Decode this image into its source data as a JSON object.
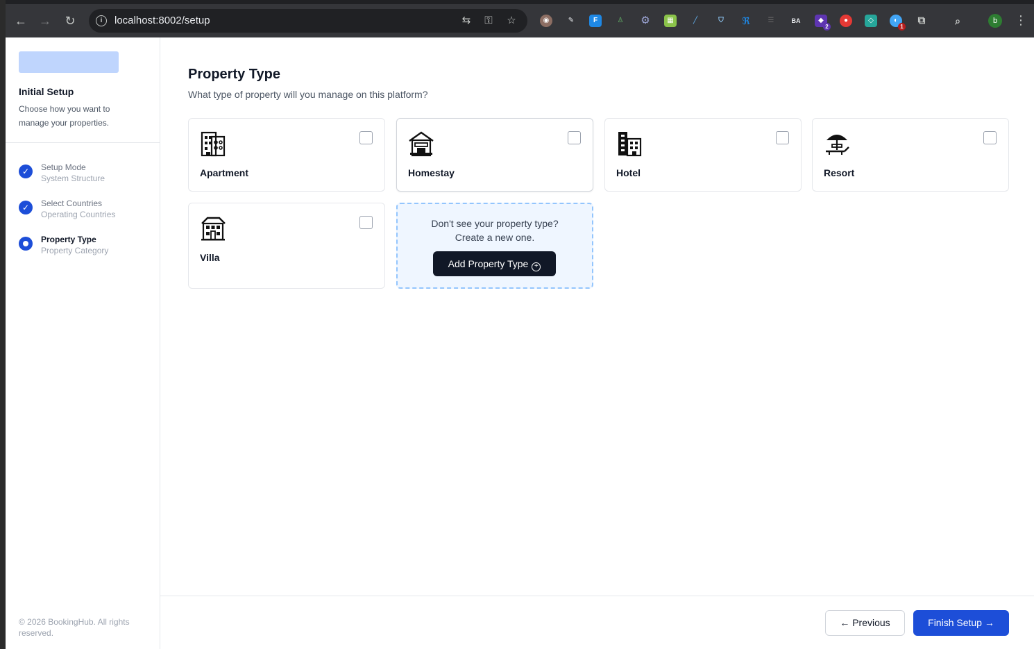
{
  "browser": {
    "url": "localhost:8002/setup",
    "profile_initial": "b",
    "extension_badges": [
      "2",
      "1"
    ]
  },
  "sidebar": {
    "title": "Initial Setup",
    "description": "Choose how you want to manage your properties.",
    "steps": [
      {
        "title": "Setup Mode",
        "subtitle": "System Structure",
        "status": "complete"
      },
      {
        "title": "Select Countries",
        "subtitle": "Operating Countries",
        "status": "complete"
      },
      {
        "title": "Property Type",
        "subtitle": "Property Category",
        "status": "current"
      }
    ],
    "footer": "© 2026 BookingHub. All rights reserved."
  },
  "main": {
    "title": "Property Type",
    "subtitle": "What type of property will you manage on this platform?",
    "property_types": [
      {
        "label": "Apartment",
        "icon": "apartment-building-icon"
      },
      {
        "label": "Homestay",
        "icon": "homestay-house-icon"
      },
      {
        "label": "Hotel",
        "icon": "hotel-building-icon"
      },
      {
        "label": "Resort",
        "icon": "resort-umbrella-icon"
      },
      {
        "label": "Villa",
        "icon": "villa-house-icon"
      }
    ],
    "add_card": {
      "line1": "Don't see your property type?",
      "line2": "Create a new one.",
      "button_label": "Add Property Type"
    }
  },
  "footer": {
    "previous_label": "← Previous",
    "finish_label": "Finish Setup →"
  },
  "colors": {
    "accent": "#1d4ed8",
    "dark_button": "#111827",
    "add_card_bg": "#eff6ff"
  }
}
